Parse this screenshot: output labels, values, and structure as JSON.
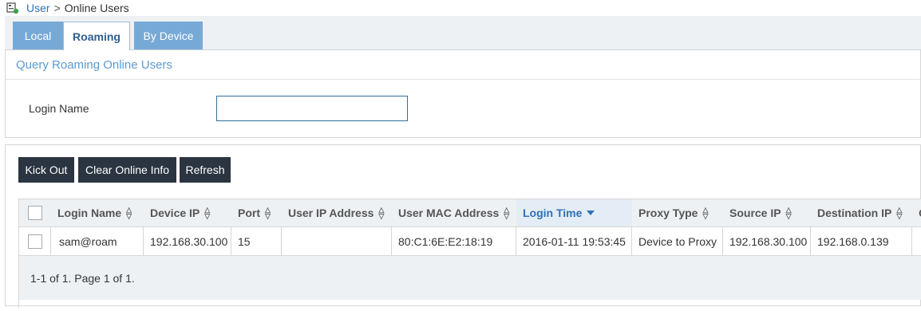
{
  "breadcrumb": {
    "root": "User",
    "separator": ">",
    "current": "Online Users",
    "icon": "home-icon"
  },
  "tabs": [
    {
      "label": "Local",
      "active": false
    },
    {
      "label": "Roaming",
      "active": true
    },
    {
      "label": "By Device",
      "active": false
    }
  ],
  "query": {
    "title": "Query Roaming Online Users",
    "login_name_label": "Login Name",
    "login_name_value": ""
  },
  "toolbar": {
    "kick_out": "Kick Out",
    "clear_online_info": "Clear Online Info",
    "refresh": "Refresh"
  },
  "table": {
    "columns": [
      {
        "label": "Login Name",
        "sort": "none"
      },
      {
        "label": "Device IP",
        "sort": "none"
      },
      {
        "label": "Port",
        "sort": "none"
      },
      {
        "label": "User IP Address",
        "sort": "none"
      },
      {
        "label": "User MAC Address",
        "sort": "none"
      },
      {
        "label": "Login Time",
        "sort": "desc"
      },
      {
        "label": "Proxy Type",
        "sort": "none"
      },
      {
        "label": "Source IP",
        "sort": "none"
      },
      {
        "label": "Destination IP",
        "sort": "none"
      },
      {
        "label": "O",
        "sort": "none"
      }
    ],
    "rows": [
      {
        "cells": [
          "sam@roam",
          "192.168.30.100",
          "15",
          "",
          "80:C1:6E:E2:18:19",
          "2016-01-11 19:53:45",
          "Device to Proxy",
          "192.168.30.100",
          "192.168.0.139",
          ""
        ]
      }
    ],
    "pagination": "1-1 of 1. Page 1 of 1."
  },
  "colors": {
    "tab_inactive": "#77a9d6",
    "button_dark": "#2b3541",
    "link_blue": "#2f72b8",
    "sorted_header": "#2f72b8"
  }
}
